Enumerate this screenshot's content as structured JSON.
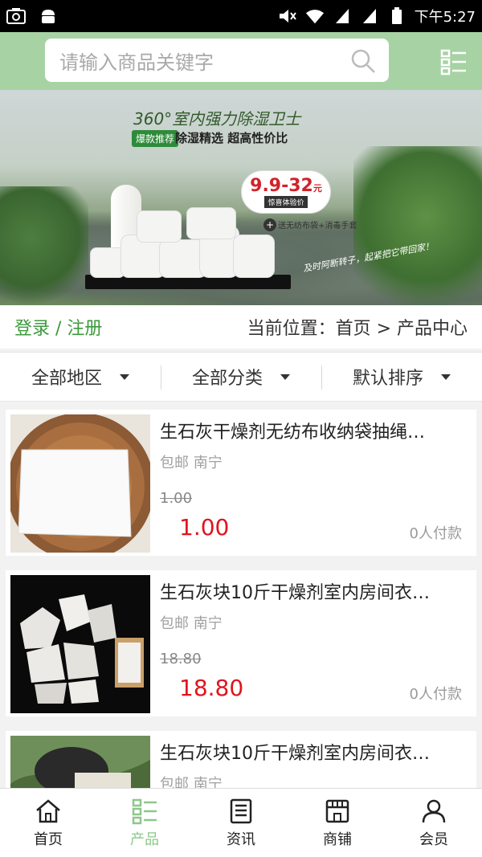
{
  "status_bar": {
    "time": "下午5:27"
  },
  "search": {
    "placeholder": "请输入商品关键字"
  },
  "banner": {
    "heading": "360°室内强力除湿卫士",
    "tag": "爆款推荐",
    "slogan": "除湿精选 超高性价比",
    "price": "9.9-32",
    "price_unit": "元",
    "price_note": "惊喜体验价",
    "gift": "送无纺布袋+消毒手套",
    "handwritten_note": "及时阿断转子，起紧把它带回家！"
  },
  "breadcrumb": {
    "login": "登录 / 注册",
    "location": "当前位置：首页 > 产品中心"
  },
  "filters": [
    {
      "label": "全部地区"
    },
    {
      "label": "全部分类"
    },
    {
      "label": "默认排序"
    }
  ],
  "products": [
    {
      "title": "生石灰干燥剂无纺布收纳袋抽绳…",
      "meta": "包邮 南宁",
      "old_price": "1.00",
      "price": "1.00",
      "sales": "0人付款"
    },
    {
      "title": "生石灰块10斤干燥剂室内房间衣…",
      "meta": "包邮 南宁",
      "old_price": "18.80",
      "price": "18.80",
      "sales": "0人付款"
    },
    {
      "title": "生石灰块10斤干燥剂室内房间衣…",
      "meta": "包邮 南宁"
    }
  ],
  "tabbar": [
    {
      "label": "首页",
      "icon": "home-icon"
    },
    {
      "label": "产品",
      "icon": "grid-list-icon",
      "active": true
    },
    {
      "label": "资讯",
      "icon": "news-icon"
    },
    {
      "label": "商铺",
      "icon": "store-icon"
    },
    {
      "label": "会员",
      "icon": "user-icon"
    }
  ],
  "colors": {
    "header_bg": "#a7d3a4",
    "accent_green": "#3c9a3c",
    "price_red": "#e0141e",
    "tab_active": "#8cc88a"
  }
}
